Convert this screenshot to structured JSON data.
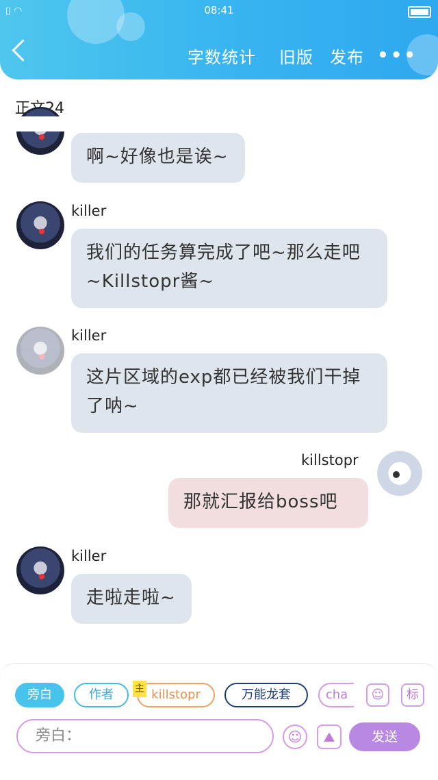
{
  "status_bar": {
    "time": "08:41"
  },
  "header": {
    "word_count_label": "字数统计",
    "old_version_label": "旧版",
    "publish_label": "发布",
    "more_label": "•••"
  },
  "chapter_title": "正文24",
  "messages": [
    {
      "user": "",
      "text": "啊~好像也是诶~"
    },
    {
      "user": "killer",
      "text": "我们的任务算完成了吧~那么走吧~Killstopr酱~"
    },
    {
      "user": "killer",
      "text": "这片区域的exp都已经被我们干掉了呐~"
    },
    {
      "user": "killstopr",
      "text": "那就汇报给boss吧"
    },
    {
      "user": "killer",
      "text": "走啦走啦~"
    }
  ],
  "roles": {
    "voiceover": "旁白",
    "author": "作者",
    "main_badge": "主",
    "killstopr": "killstopr",
    "wanneng": "万能龙套",
    "partial": "cha"
  },
  "side_buttons": {
    "tag_label": "标"
  },
  "input": {
    "placeholder": "旁白："
  },
  "send_label": "发送",
  "colors": {
    "header": "#37b4f0",
    "bubble_left": "#dfe5ec",
    "bubble_right": "#f2dede",
    "accent_purple": "#b889e2"
  }
}
